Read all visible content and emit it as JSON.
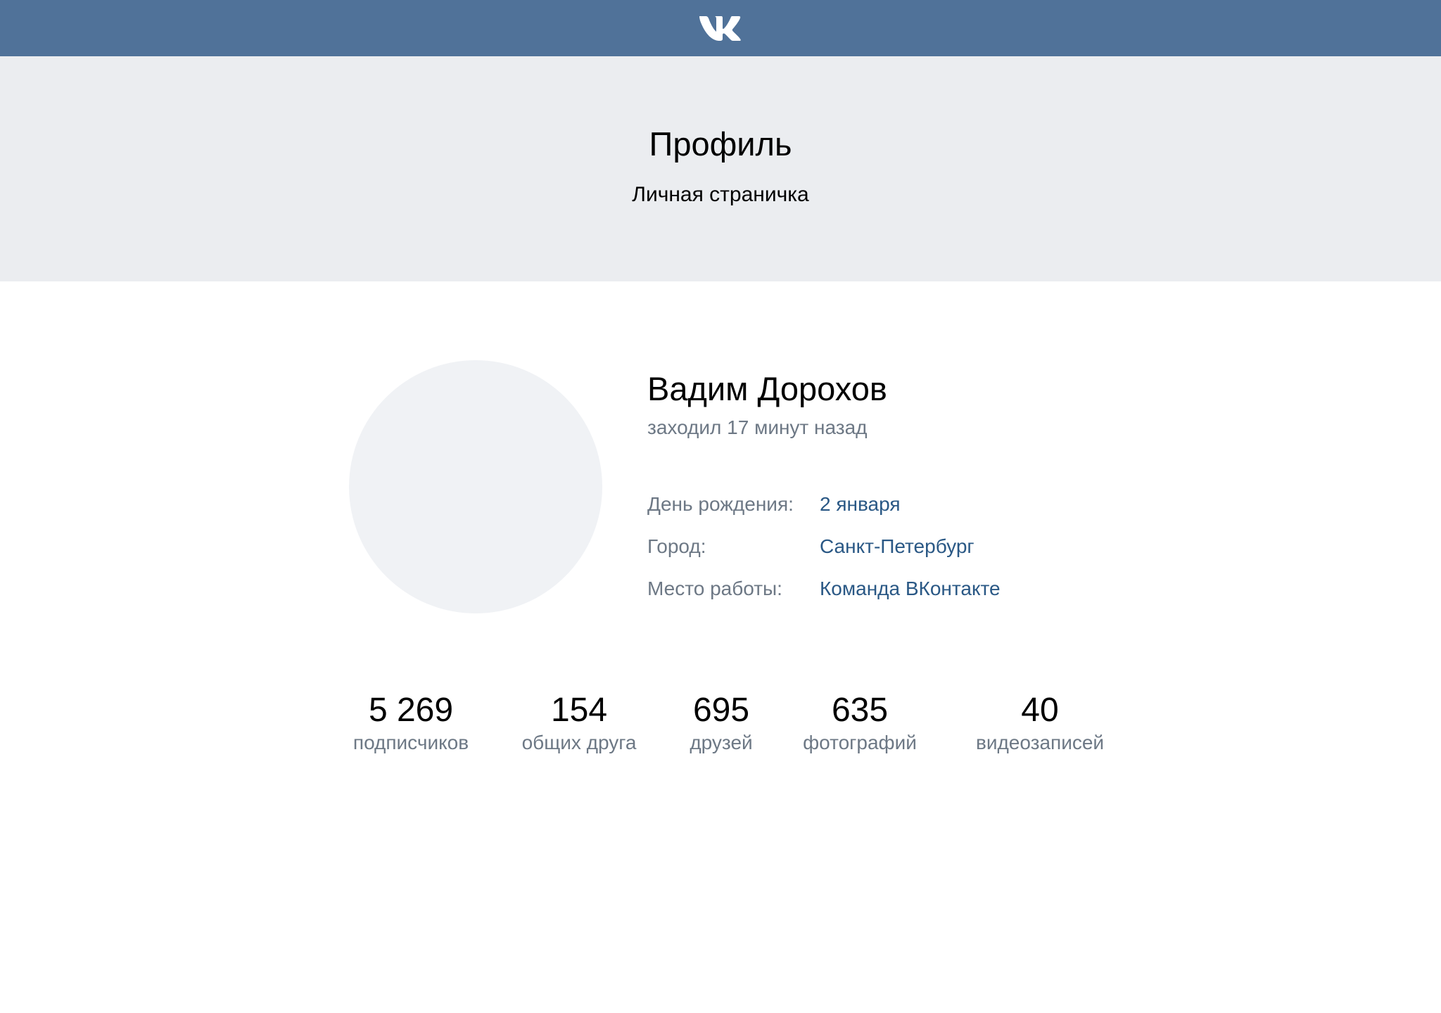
{
  "colors": {
    "topbar": "#507299",
    "hero_background": "#ebedf0",
    "avatar_placeholder": "#f0f2f5",
    "link": "#2a5885",
    "secondary_text": "#6d7885"
  },
  "topbar": {
    "logo_icon": "vk-logo-icon"
  },
  "hero": {
    "title": "Профиль",
    "subtitle": "Личная страничка"
  },
  "profile": {
    "name": "Вадим Дорохов",
    "last_seen": "заходил 17 минут назад",
    "info": [
      {
        "label": "День рождения:",
        "value": "2 января"
      },
      {
        "label": "Город:",
        "value": "Санкт-Петербург"
      },
      {
        "label": "Место работы:",
        "value": "Команда ВКонтакте"
      }
    ]
  },
  "counters": [
    {
      "value": "5 269",
      "caption": "подписчиков"
    },
    {
      "value": "154",
      "caption": "общих друга"
    },
    {
      "value": "695",
      "caption": "друзей"
    },
    {
      "value": "635",
      "caption": "фотографий"
    },
    {
      "value": "40",
      "caption": "видеозаписей"
    }
  ]
}
